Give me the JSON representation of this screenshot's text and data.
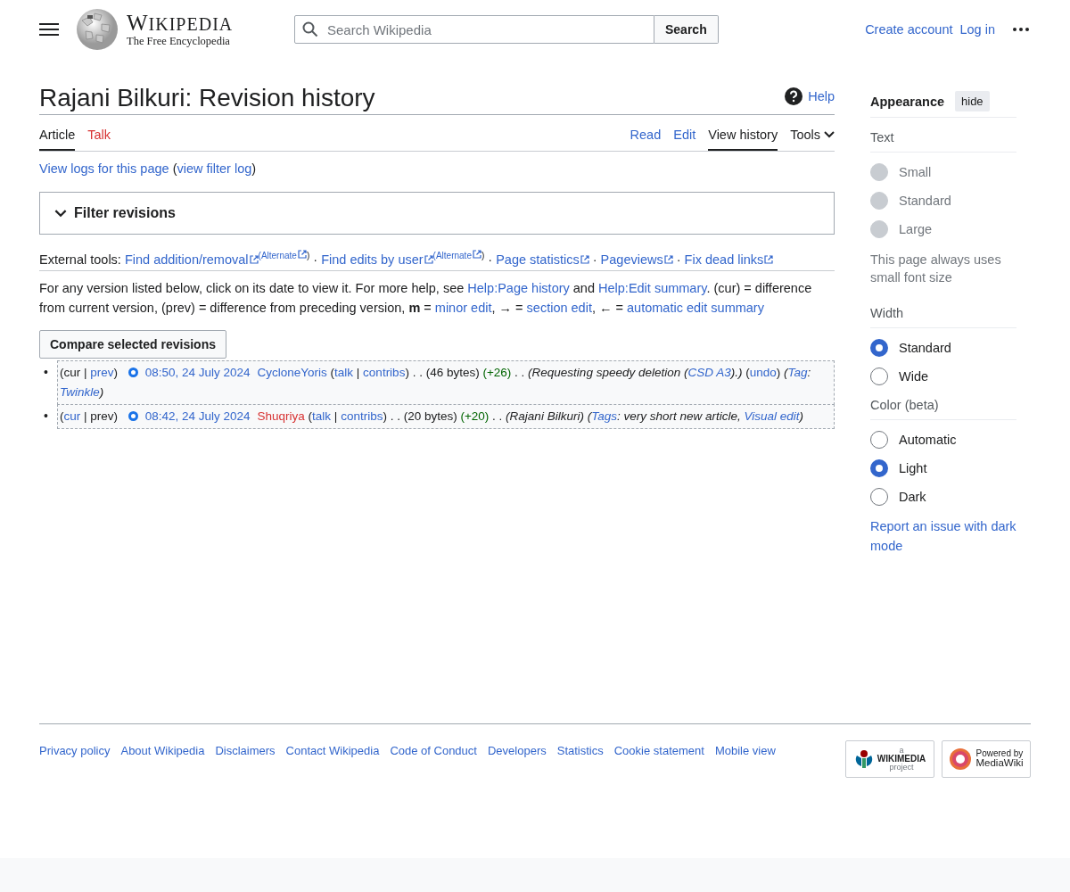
{
  "header": {
    "wordmark": "WIKIPEDIA",
    "tagline": "The Free Encyclopedia",
    "search_placeholder": "Search Wikipedia",
    "search_button": "Search",
    "user_links": [
      "Create account",
      "Log in"
    ]
  },
  "page": {
    "title": "Rajani Bilkuri: Revision history",
    "help": "Help",
    "tabs_left": [
      {
        "label": "Article",
        "selected": true,
        "missing": false
      },
      {
        "label": "Talk",
        "selected": false,
        "missing": true
      }
    ],
    "tabs_right": [
      {
        "label": "Read",
        "selected": false,
        "kind": "link"
      },
      {
        "label": "Edit",
        "selected": false,
        "kind": "link"
      },
      {
        "label": "View history",
        "selected": true,
        "kind": "link"
      },
      {
        "label": "Tools",
        "selected": false,
        "kind": "menu"
      }
    ],
    "logs": [
      {
        "text": "View logs for this page",
        "kind": "link"
      },
      {
        "text": " (",
        "kind": "text"
      },
      {
        "text": "view filter log",
        "kind": "link"
      },
      {
        "text": ")",
        "kind": "text"
      }
    ],
    "filter": {
      "label": "Filter revisions",
      "expanded": false
    },
    "external_tools": [
      {
        "text": "External tools: ",
        "kind": "text"
      },
      {
        "text": "Find addition/removal",
        "kind": "ext"
      },
      {
        "text": "(Alternate",
        "kind": "sup"
      },
      {
        "text": ")",
        "kind": "suptext"
      },
      {
        "text": " · ",
        "kind": "text"
      },
      {
        "text": "Find edits by user",
        "kind": "ext"
      },
      {
        "text": "(Alternate",
        "kind": "sup"
      },
      {
        "text": ")",
        "kind": "suptext"
      },
      {
        "text": " · ",
        "kind": "text"
      },
      {
        "text": "Page statistics",
        "kind": "ext"
      },
      {
        "text": " · ",
        "kind": "text"
      },
      {
        "text": "Pageviews",
        "kind": "ext"
      },
      {
        "text": " · ",
        "kind": "text"
      },
      {
        "text": "Fix dead links",
        "kind": "ext"
      }
    ],
    "help_text": [
      {
        "text": "For any version listed below, click on its date to view it. For more help, see ",
        "kind": "text"
      },
      {
        "text": "Help:Page history",
        "kind": "link"
      },
      {
        "text": " and ",
        "kind": "text"
      },
      {
        "text": "Help:Edit summary",
        "kind": "link"
      },
      {
        "text": ". (cur) = difference from current version, (prev) = difference from preceding version, **m** = ",
        "kind": "text"
      },
      {
        "text": "minor edit",
        "kind": "link"
      },
      {
        "text": ", → = ",
        "kind": "text"
      },
      {
        "text": "section edit",
        "kind": "link"
      },
      {
        "text": ", ← = ",
        "kind": "text"
      },
      {
        "text": "automatic edit summary",
        "kind": "link"
      }
    ],
    "compare_button": "Compare selected revisions",
    "revisions": [
      {
        "bullet": "•",
        "segments": [
          {
            "text": "(cur | ",
            "kind": "text"
          },
          {
            "text": "prev",
            "kind": "link"
          },
          {
            "text": ") ",
            "kind": "text"
          },
          {
            "kind": "radio",
            "selected": true
          },
          {
            "text": "08:50, 24 July 2024",
            "kind": "date"
          },
          {
            "text": "CycloneYoris",
            "kind": "link"
          },
          {
            "text": " (",
            "kind": "text"
          },
          {
            "text": "talk",
            "kind": "link"
          },
          {
            "text": " | ",
            "kind": "text"
          },
          {
            "text": "contribs",
            "kind": "link"
          },
          {
            "text": ") . . (46 bytes) ",
            "kind": "text"
          },
          {
            "text": "(+26)",
            "kind": "plus"
          },
          {
            "text": " . . ",
            "kind": "text"
          },
          {
            "text": "(Requesting speedy deletion (",
            "kind": "italic"
          },
          {
            "text": "CSD A3",
            "kind": "italic-link"
          },
          {
            "text": ").)",
            "kind": "italic"
          },
          {
            "text": " (",
            "kind": "text"
          },
          {
            "text": "undo",
            "kind": "link"
          },
          {
            "text": ") ",
            "kind": "text"
          },
          {
            "text": "(",
            "kind": "italic"
          },
          {
            "text": "Tag",
            "kind": "italic-link"
          },
          {
            "text": ": ",
            "kind": "italic"
          },
          {
            "text": "Twinkle",
            "kind": "italic-link"
          },
          {
            "text": ")",
            "kind": "italic"
          }
        ]
      },
      {
        "bullet": "•",
        "segments": [
          {
            "text": "(",
            "kind": "text"
          },
          {
            "text": "cur",
            "kind": "link"
          },
          {
            "text": " | prev) ",
            "kind": "text"
          },
          {
            "kind": "radio",
            "selected": true
          },
          {
            "text": "08:42, 24 July 2024",
            "kind": "date"
          },
          {
            "text": "Shuqriya",
            "kind": "redlink"
          },
          {
            "text": " (",
            "kind": "text"
          },
          {
            "text": "talk",
            "kind": "link"
          },
          {
            "text": " | ",
            "kind": "text"
          },
          {
            "text": "contribs",
            "kind": "link"
          },
          {
            "text": ") . . (20 bytes) ",
            "kind": "text"
          },
          {
            "text": "(+20)",
            "kind": "plus"
          },
          {
            "text": " . . ",
            "kind": "text"
          },
          {
            "text": "(Rajani Bilkuri) ",
            "kind": "italic"
          },
          {
            "text": "(",
            "kind": "italic"
          },
          {
            "text": "Tags",
            "kind": "italic-link"
          },
          {
            "text": ": very short new article, ",
            "kind": "italic"
          },
          {
            "text": "Visual edit",
            "kind": "italic-link"
          },
          {
            "text": ")",
            "kind": "italic"
          }
        ]
      }
    ]
  },
  "appearance": {
    "title": "Appearance",
    "hide_button": "hide",
    "sections": [
      {
        "heading": "Text",
        "options": [
          {
            "label": "Small",
            "selected": false,
            "disabled": true
          },
          {
            "label": "Standard",
            "selected": false,
            "disabled": true
          },
          {
            "label": "Large",
            "selected": false,
            "disabled": true
          }
        ],
        "note": "This page always uses small font size"
      },
      {
        "heading": "Width",
        "options": [
          {
            "label": "Standard",
            "selected": true,
            "disabled": false
          },
          {
            "label": "Wide",
            "selected": false,
            "disabled": false
          }
        ]
      },
      {
        "heading": "Color (beta)",
        "options": [
          {
            "label": "Automatic",
            "selected": false,
            "disabled": false
          },
          {
            "label": "Light",
            "selected": true,
            "disabled": false
          },
          {
            "label": "Dark",
            "selected": false,
            "disabled": false
          }
        ]
      }
    ],
    "report_link": "Report an issue with dark mode"
  },
  "footer": {
    "links": [
      "Privacy policy",
      "About Wikipedia",
      "Disclaimers",
      "Contact Wikipedia",
      "Code of Conduct",
      "Developers",
      "Statistics",
      "Cookie statement",
      "Mobile view"
    ],
    "badges": [
      {
        "kind": "wikimedia",
        "lines": [
          "a",
          "WIKIMEDIA",
          "project"
        ]
      },
      {
        "kind": "mediawiki",
        "lines": [
          "Powered by",
          "MediaWiki"
        ]
      }
    ]
  }
}
